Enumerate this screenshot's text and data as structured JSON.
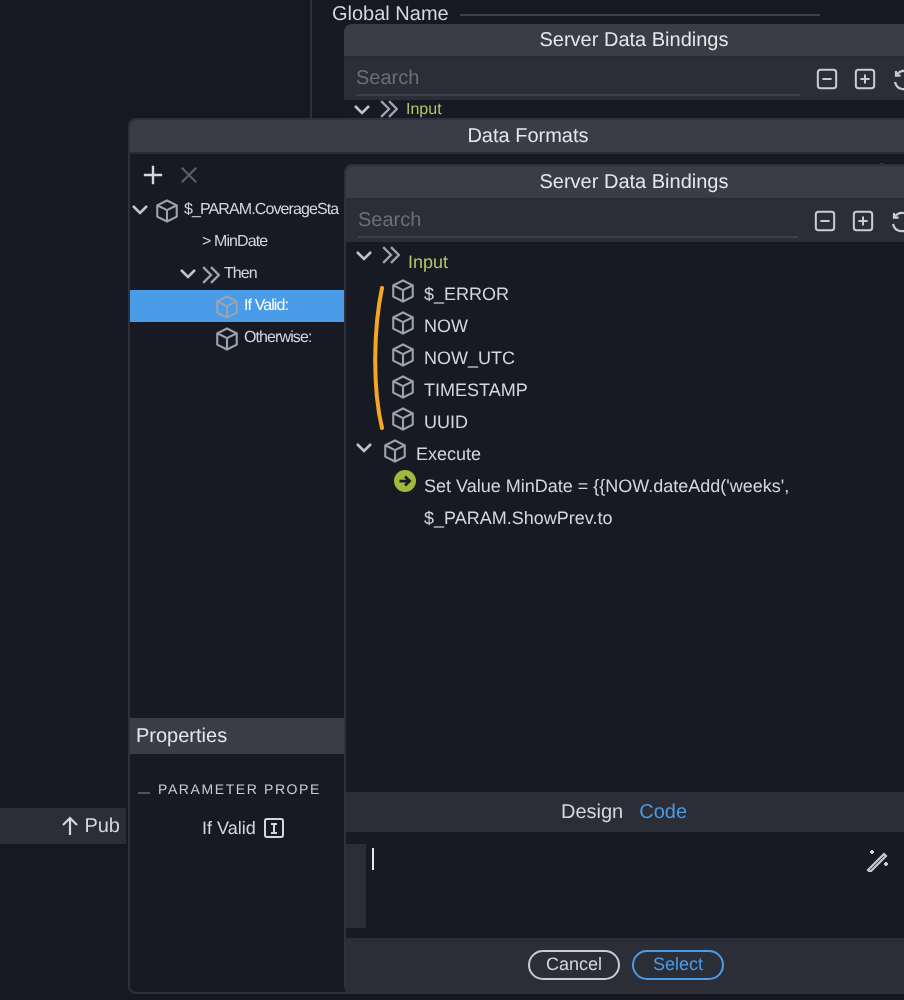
{
  "background": {
    "field_label": "Global Name",
    "publish_button": "Pub"
  },
  "back_bindings": {
    "title": "Server Data Bindings",
    "search_placeholder": "Search",
    "input_label": "Input"
  },
  "data_formats": {
    "title": "Data Formats",
    "tree": [
      {
        "label": "$_PARAM.CoverageSta",
        "kind": "item",
        "expanded": true,
        "selected": false,
        "children": [
          {
            "label": "> MinDate",
            "kind": "plain",
            "selected": false
          },
          {
            "label": "Then",
            "kind": "input",
            "expanded": true,
            "selected": false,
            "children": [
              {
                "label": "If Valid:",
                "kind": "item",
                "selected": true
              },
              {
                "label": "Otherwise:",
                "kind": "item",
                "selected": false
              }
            ]
          }
        ]
      }
    ],
    "properties": {
      "title": "Properties",
      "section": "PARAMETER PROPE",
      "field_label": "If Valid"
    }
  },
  "front_bindings": {
    "title": "Server Data Bindings",
    "search_placeholder": "Search",
    "tree": [
      {
        "label": "Input",
        "kind": "input",
        "expanded": true,
        "children": [
          {
            "label": "$_ERROR",
            "kind": "item"
          },
          {
            "label": "NOW",
            "kind": "item"
          },
          {
            "label": "NOW_UTC",
            "kind": "item"
          },
          {
            "label": "TIMESTAMP",
            "kind": "item"
          },
          {
            "label": "UUID",
            "kind": "item"
          }
        ]
      },
      {
        "label": "Execute",
        "kind": "item",
        "expanded": true,
        "children": [
          {
            "label": "Set Value MinDate = {{NOW.dateAdd('weeks', $_PARAM.ShowPrev.to",
            "kind": "action"
          }
        ]
      }
    ],
    "tabs": [
      {
        "label": "Design",
        "selected": false
      },
      {
        "label": "Code",
        "selected": true
      }
    ],
    "buttons": [
      {
        "label": "Cancel",
        "primary": false
      },
      {
        "label": "Select",
        "primary": true
      }
    ]
  }
}
